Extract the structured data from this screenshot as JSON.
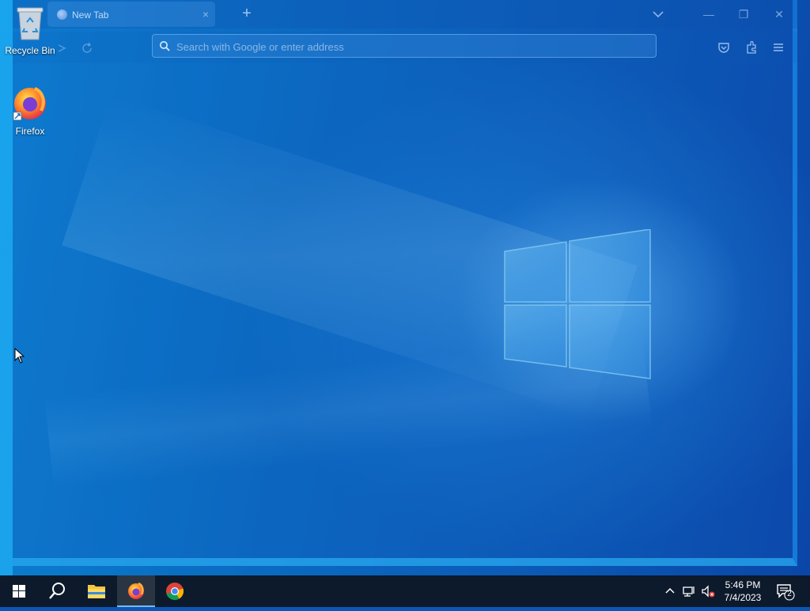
{
  "desktop": {
    "icons": [
      {
        "label": "Recycle Bin",
        "icon": "recycle-bin-icon"
      },
      {
        "label": "Firefox",
        "icon": "firefox-icon"
      }
    ]
  },
  "browser": {
    "tab": {
      "title": "New Tab",
      "close": "×"
    },
    "newtab_glyph": "+",
    "urlbar": {
      "placeholder": "Search with Google or enter address",
      "value": ""
    },
    "window_controls": {
      "minimize": "—",
      "restore": "❐",
      "close": "✕"
    }
  },
  "taskbar": {
    "pinned": [
      {
        "name": "start",
        "icon": "windows-start-icon"
      },
      {
        "name": "search",
        "icon": "search-icon"
      },
      {
        "name": "file-explorer",
        "icon": "file-explorer-icon"
      },
      {
        "name": "firefox",
        "icon": "firefox-icon",
        "active": true
      },
      {
        "name": "chrome",
        "icon": "chrome-icon"
      }
    ],
    "clock": {
      "time": "5:46 PM",
      "date": "7/4/2023"
    },
    "notifications_count": "2"
  },
  "colors": {
    "taskbar": "#0d1a2b",
    "accent": "#76b9ed",
    "wallpaper_blue": "#0a6fc4"
  }
}
